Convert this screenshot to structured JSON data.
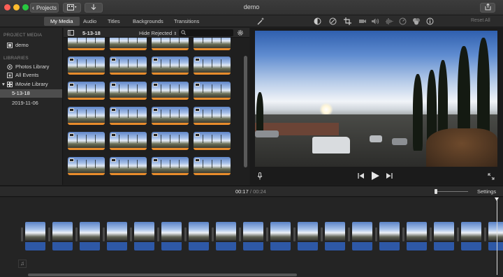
{
  "window": {
    "title": "demo",
    "projects_label": "Projects"
  },
  "tabs": [
    "My Media",
    "Audio",
    "Titles",
    "Backgrounds",
    "Transitions"
  ],
  "sidebar": {
    "project_media_header": "PROJECT MEDIA",
    "project": "demo",
    "libraries_header": "LIBRARIES",
    "items": [
      "Photos Library",
      "All Events",
      "iMovie Library",
      "5-13-18",
      "2019-11-06"
    ]
  },
  "browser": {
    "event_title": "5-13-18",
    "filter": "Hide Rejected",
    "search_placeholder": ""
  },
  "viewer": {
    "reset_all": "Reset All"
  },
  "timeline": {
    "current_time": "00:17",
    "separator": "/",
    "total_time": "00:24",
    "settings_label": "Settings"
  },
  "colors": {
    "accent_selection": "#e88c2c",
    "audio_clip": "#2e58a6"
  },
  "icons": [
    "back-chevron-icon",
    "media-import-icon",
    "download-arrow-icon",
    "share-icon",
    "magic-wand-icon",
    "color-balance-icon",
    "color-correction-icon",
    "crop-icon",
    "stabilization-icon",
    "volume-icon",
    "noise-reduction-icon",
    "speed-icon",
    "clip-filter-icon",
    "info-icon",
    "sidebar-toggle-icon",
    "search-icon",
    "gear-icon",
    "microphone-icon",
    "skip-back-icon",
    "play-icon",
    "skip-forward-icon",
    "fullscreen-icon",
    "music-note-icon"
  ]
}
